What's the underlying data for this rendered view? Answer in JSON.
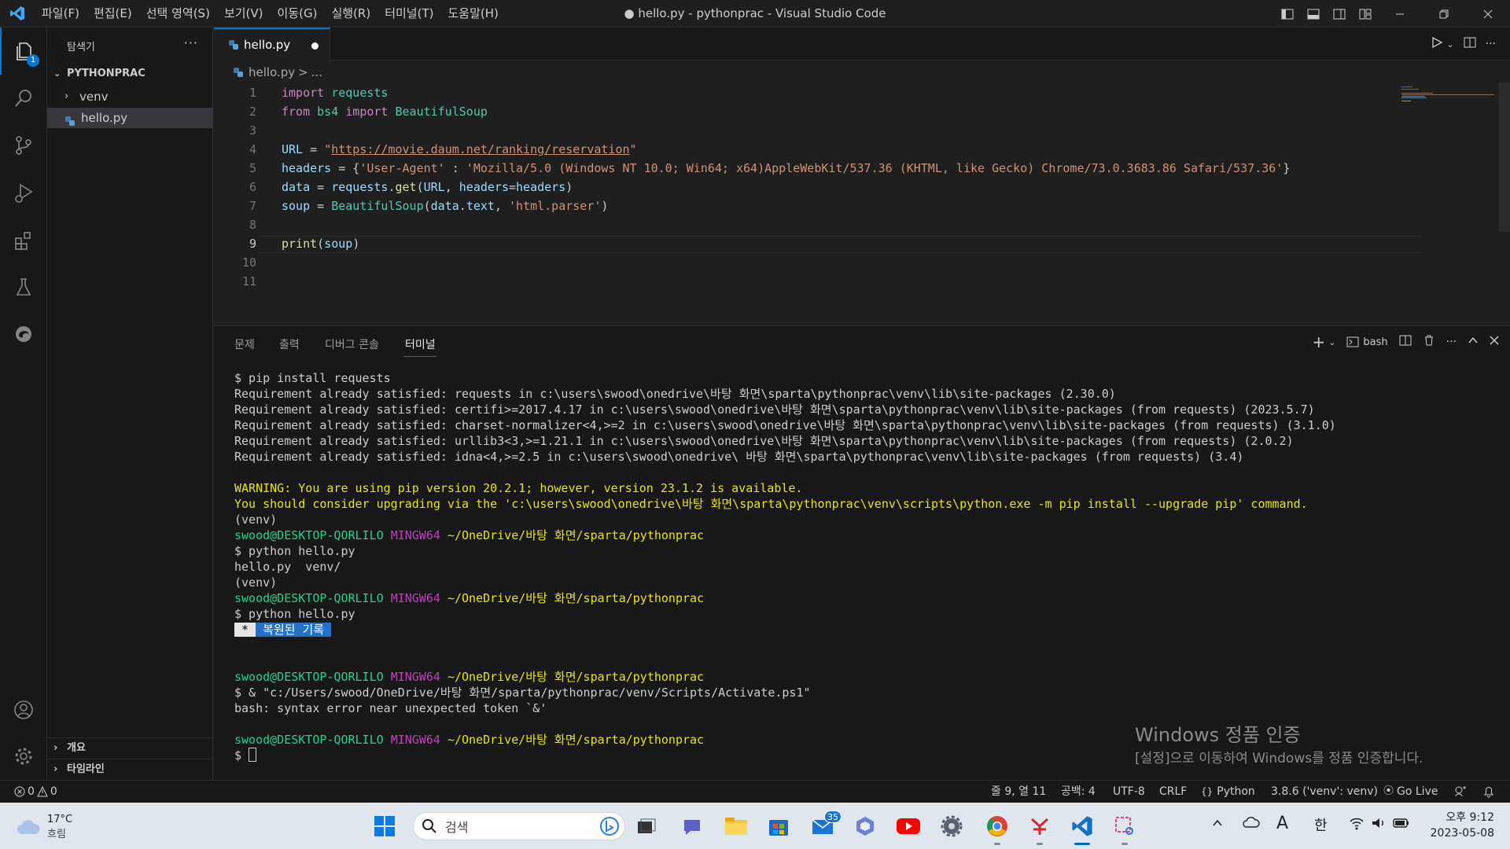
{
  "window": {
    "title": "● hello.py - pythonprac - Visual Studio Code",
    "menu": [
      "파일(F)",
      "편집(E)",
      "선택 영역(S)",
      "보기(V)",
      "이동(G)",
      "실행(R)",
      "터미널(T)",
      "도움말(H)"
    ]
  },
  "activity_bar": {
    "explorer_badge": "1"
  },
  "sidebar": {
    "title": "탐색기",
    "more": "···",
    "root": "PYTHONPRAC",
    "items": [
      {
        "label": "venv",
        "type": "folder"
      },
      {
        "label": "hello.py",
        "type": "file"
      }
    ],
    "outline": "개요",
    "timeline": "타임라인"
  },
  "tab": {
    "label": "hello.py"
  },
  "breadcrumb": {
    "file": "hello.py",
    "sep": ">",
    "more": "..."
  },
  "editor": {
    "line_numbers": [
      "1",
      "2",
      "3",
      "4",
      "5",
      "6",
      "7",
      "8",
      "9",
      "10",
      "11"
    ],
    "current_line": 9,
    "lines": {
      "l1_kw": "import",
      "l1_mod": " requests",
      "l2_kw1": "from",
      "l2_mod1": " bs4",
      "l2_kw2": " import",
      "l2_mod2": " BeautifulSoup",
      "l4_var": "URL",
      "l4_eq": " = ",
      "l4_q1": "\"",
      "l4_url": "https://movie.daum.net/ranking/reservation",
      "l4_q2": "\"",
      "l5_var": "headers",
      "l5_eq": " = {",
      "l5_key": "'User-Agent'",
      "l5_colon": " : ",
      "l5_val": "'Mozilla/5.0 (Windows NT 10.0; Win64; x64)AppleWebKit/537.36 (KHTML, like Gecko) Chrome/73.0.3683.86 Safari/537.36'",
      "l5_end": "}",
      "l6_var": "data",
      "l6_eq": " = ",
      "l6_mod": "requests",
      "l6_dot": ".",
      "l6_fn": "get",
      "l6_p1": "(",
      "l6_arg1": "URL",
      "l6_c": ", ",
      "l6_arg2": "headers",
      "l6_eq2": "=",
      "l6_arg3": "headers",
      "l6_p2": ")",
      "l7_var": "soup",
      "l7_eq": " = ",
      "l7_cls": "BeautifulSoup",
      "l7_p1": "(",
      "l7_arg1": "data",
      "l7_dot": ".",
      "l7_arg2": "text",
      "l7_c": ", ",
      "l7_str": "'html.parser'",
      "l7_p2": ")",
      "l9_fn": "print",
      "l9_p1": "(",
      "l9_arg": "soup",
      "l9_p2": ")"
    }
  },
  "panel": {
    "tabs": [
      "문제",
      "출력",
      "디버그 콘솔",
      "터미널"
    ],
    "active_tab": "터미널",
    "shell": "bash",
    "terminal": {
      "t1": "$ pip install requests",
      "t2": "Requirement already satisfied: requests in c:\\users\\swood\\onedrive\\바탕 화면\\sparta\\pythonprac\\venv\\lib\\site-packages (2.30.0)",
      "t3": "Requirement already satisfied: certifi>=2017.4.17 in c:\\users\\swood\\onedrive\\바탕 화면\\sparta\\pythonprac\\venv\\lib\\site-packages (from requests) (2023.5.7)",
      "t4": "Requirement already satisfied: charset-normalizer<4,>=2 in c:\\users\\swood\\onedrive\\바탕 화면\\sparta\\pythonprac\\venv\\lib\\site-packages (from requests) (3.1.0)",
      "t5": "Requirement already satisfied: urllib3<3,>=1.21.1 in c:\\users\\swood\\onedrive\\바탕 화면\\sparta\\pythonprac\\venv\\lib\\site-packages (from requests) (2.0.2)",
      "t6": "Requirement already satisfied: idna<4,>=2.5 in c:\\users\\swood\\onedrive\\ 바탕 화면\\sparta\\pythonprac\\venv\\lib\\site-packages (from requests) (3.4)",
      "w1": "WARNING: You are using pip version 20.2.1; however, version 23.1.2 is available.",
      "w2": "You should consider upgrading via the 'c:\\users\\swood\\onedrive\\바탕 화면\\sparta\\pythonprac\\venv\\scripts\\python.exe -m pip install --upgrade pip' command.",
      "venv": "(venv)",
      "user": "swood@DESKTOP-QORLILO",
      "sys": "MINGW64",
      "path": "~/OneDrive/바탕 화면/sparta/pythonprac",
      "c1": "$ python hello.py",
      "o1": "hello.py  venv/",
      "c2": "$ python hello.py",
      "restored_star": " * ",
      "restored": " 복원된 기록 ",
      "c3": "$ & \"c:/Users/swood/OneDrive/바탕 화면/sparta/pythonprac/venv/Scripts/Activate.ps1\"",
      "e1": "bash: syntax error near unexpected token `&'",
      "prompt": "$ "
    },
    "watermark_title": "Windows 정품 인증",
    "watermark_sub": "[설정]으로 이동하여 Windows를 정품 인증합니다."
  },
  "statusbar": {
    "errors": "0",
    "warnings": "0",
    "position": "줄 9, 열 11",
    "spaces": "공백: 4",
    "encoding": "UTF-8",
    "eol": "CRLF",
    "language": "Python",
    "interpreter": "3.8.6 ('venv': venv)",
    "golive": "Go Live"
  },
  "taskbar": {
    "weather_temp": "17°C",
    "weather_desc": "흐림",
    "search_placeholder": "검색",
    "mail_badge": "35",
    "ime": "한",
    "font_mode": "A",
    "time": "오후 9:12",
    "date": "2023-05-08"
  }
}
